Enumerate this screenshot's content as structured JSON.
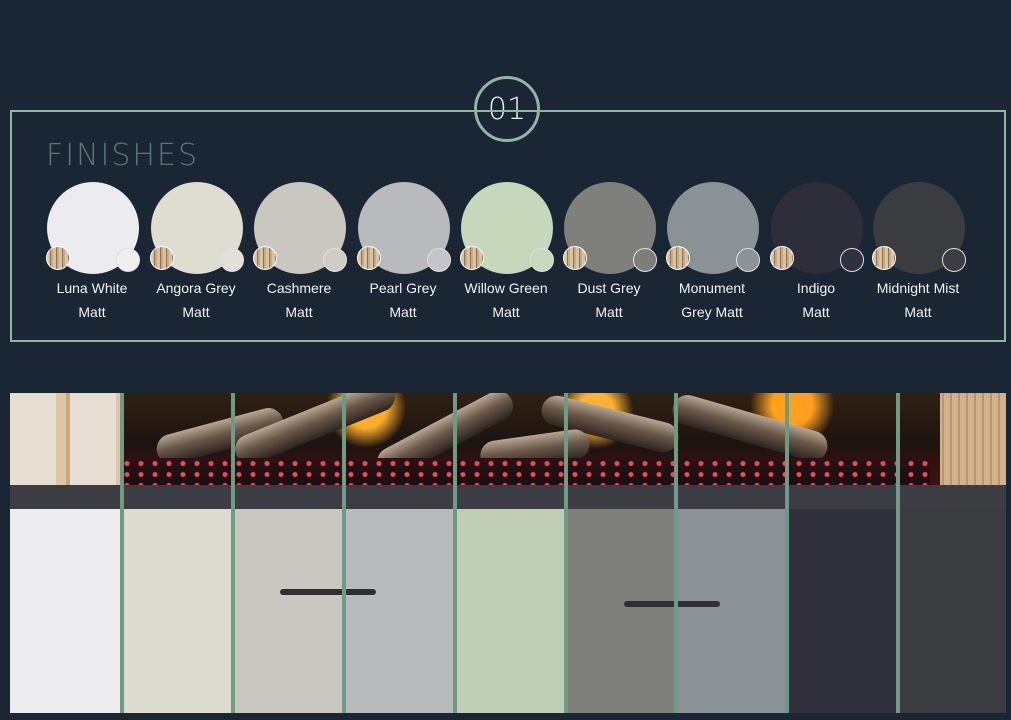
{
  "badge": "01",
  "title": "FINISHES",
  "swatches": [
    {
      "line1": "Luna White",
      "line2": "Matt",
      "color": "#ececef",
      "mini": "#efefef"
    },
    {
      "line1": "Angora Grey",
      "line2": "Matt",
      "color": "#dfdcd1",
      "mini": "#e2e0d7"
    },
    {
      "line1": "Cashmere",
      "line2": "Matt",
      "color": "#cac7c1",
      "mini": "#d0ccc6"
    },
    {
      "line1": "Pearl Grey",
      "line2": "Matt",
      "color": "#b8babb",
      "mini": "#c4c5c6"
    },
    {
      "line1": "Willow Green",
      "line2": "Matt",
      "color": "#c7d7bc",
      "mini": "#c8d8be"
    },
    {
      "line1": "Dust Grey",
      "line2": "Matt",
      "color": "#7f807c",
      "mini": "#7d7e7a"
    },
    {
      "line1": "Monument",
      "line2": "Grey Matt",
      "color": "#8a9296",
      "mini": "#8b9397"
    },
    {
      "line1": "Indigo",
      "line2": "Matt",
      "color": "#2d2e39",
      "mini": "#303140"
    },
    {
      "line1": "Midnight Mist",
      "line2": "Matt",
      "color": "#3a3c3f",
      "mini": "#3b3d40"
    }
  ],
  "colors": {
    "accent": "#8fb7a4",
    "background": "#1a2634"
  }
}
